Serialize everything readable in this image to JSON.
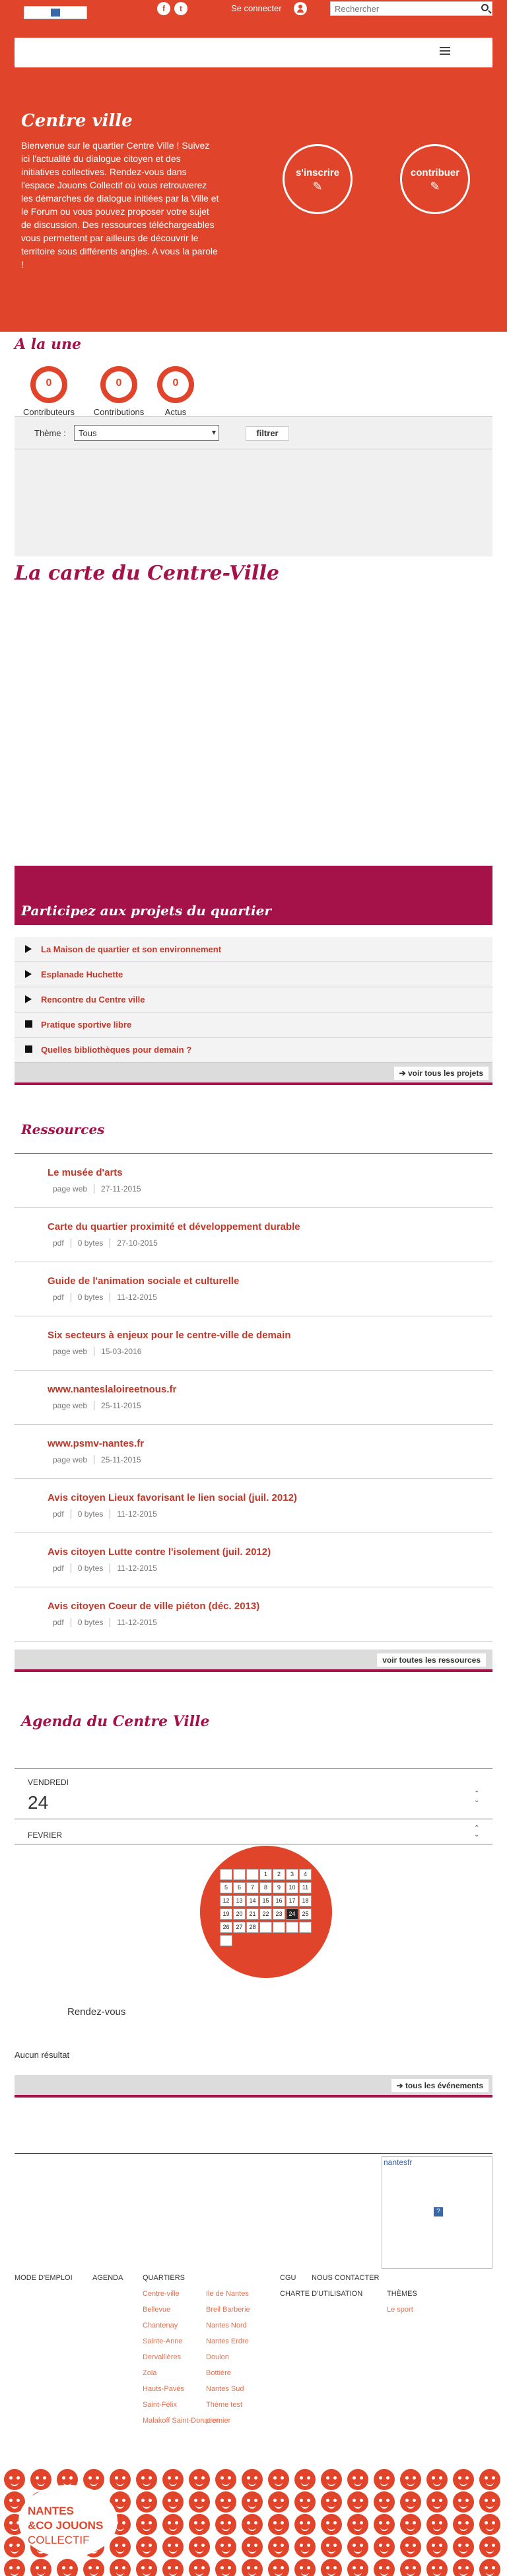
{
  "header": {
    "connect_label": "Se connecter",
    "search_placeholder": "Rechercher",
    "social": [
      "f",
      "t"
    ]
  },
  "hero": {
    "title": "Centre ville",
    "text": "Bienvenue sur le quartier Centre Ville ! Suivez ici l'actualité du dialogue citoyen et des initiatives collectives. Rendez-vous dans l'espace Jouons Collectif où vous retrouverez les démarches de dialogue initiées par la Ville et le Forum ou vous pouvez proposer votre sujet de discussion. Des ressources téléchargeables vous permettent par ailleurs de découvrir le territoire sous différents angles. A vous la parole !",
    "subscribe_label": "s'inscrire",
    "contribute_label": "contribuer"
  },
  "alaune": {
    "title": "A la une",
    "stats": [
      {
        "value": "0",
        "label": "Contributeurs"
      },
      {
        "value": "0",
        "label": "Contributions"
      },
      {
        "value": "0",
        "label": "Actus"
      }
    ],
    "filter": {
      "label": "Thème :",
      "selected": "Tous",
      "button": "filtrer"
    }
  },
  "map": {
    "title": "La carte du Centre-Ville"
  },
  "projects": {
    "title": "Participez aux projets du quartier",
    "items": [
      {
        "label": "La Maison de quartier et son environnement",
        "marker": "triangle"
      },
      {
        "label": "Esplanade Huchette",
        "marker": "triangle"
      },
      {
        "label": "Rencontre du Centre ville",
        "marker": "triangle"
      },
      {
        "label": "Pratique sportive libre",
        "marker": "square"
      },
      {
        "label": "Quelles bibliothèques pour demain ?",
        "marker": "square"
      }
    ],
    "more_label": "voir tous les projets"
  },
  "resources": {
    "title": "Ressources",
    "items": [
      {
        "title": "Le musée d'arts",
        "type": "page web",
        "size": "",
        "date": "27-11-2015"
      },
      {
        "title": "Carte du quartier proximité et développement durable",
        "type": "pdf",
        "size": "0 bytes",
        "date": "27-10-2015"
      },
      {
        "title": "Guide de l'animation sociale et culturelle",
        "type": "pdf",
        "size": "0 bytes",
        "date": "11-12-2015"
      },
      {
        "title": "Six secteurs à enjeux pour le centre-ville de demain",
        "type": "page web",
        "size": "",
        "date": "15-03-2016"
      },
      {
        "title": "www.nanteslaloireetnous.fr",
        "type": "page web",
        "size": "",
        "date": "25-11-2015"
      },
      {
        "title": "www.psmv-nantes.fr",
        "type": "page web",
        "size": "",
        "date": "25-11-2015"
      },
      {
        "title": "Avis citoyen Lieux favorisant le lien social (juil. 2012)",
        "type": "pdf",
        "size": "0 bytes",
        "date": "11-12-2015"
      },
      {
        "title": "Avis citoyen Lutte contre l'isolement (juil. 2012)",
        "type": "pdf",
        "size": "0 bytes",
        "date": "11-12-2015"
      },
      {
        "title": "Avis citoyen Coeur de ville piéton (déc. 2013)",
        "type": "pdf",
        "size": "0 bytes",
        "date": "11-12-2015"
      }
    ],
    "more_label": "voir toutes les ressources"
  },
  "agenda": {
    "title": "Agenda du Centre Ville",
    "weekday": "VENDREDI",
    "day": "24",
    "month": "FEVRIER",
    "calendar_days": [
      "",
      "",
      "",
      "1",
      "2",
      "3",
      "4",
      "5",
      "6",
      "7",
      "8",
      "9",
      "10",
      "11",
      "12",
      "13",
      "14",
      "15",
      "16",
      "17",
      "18",
      "19",
      "20",
      "21",
      "22",
      "23",
      "24",
      "25",
      "26",
      "27",
      "28",
      "",
      "",
      "",
      "",
      ""
    ],
    "today": "24",
    "rdv_label": "Rendez-vous",
    "no_result": "Aucun résultat",
    "more_label": "tous les événements"
  },
  "footer": {
    "box_link": "nantesfr",
    "box_icon": "?",
    "nav": [
      "MODE D'EMPLOI",
      "AGENDA",
      "QUARTIERS",
      "CGU",
      "NOUS CONTACTER"
    ],
    "charter": "CHARTE D'UTILISATION",
    "themes": "THÈMES",
    "themes_items": [
      "Le sport"
    ],
    "quartiers_col1": [
      "Centre-ville",
      "Bellevue",
      "Chantenay",
      "Sainte-Anne",
      "Dervallières",
      "Zola",
      "Hauts-Pavés",
      "Saint-Félix",
      "Malakoff Saint-Donatien"
    ],
    "quartiers_col2": [
      "Ile de Nantes",
      "Breil Barberie",
      "Nantes Nord",
      "Nantes Erdre",
      "Doulon",
      "Bottière",
      "Nantes Sud",
      "Thème test",
      "premier"
    ],
    "logo": {
      "line1": "NANTES",
      "line2": "&CO JOUONS",
      "line3": "COLLECTIF"
    }
  },
  "colors": {
    "accent": "#e0452b",
    "brand_dark": "#a5124a"
  }
}
